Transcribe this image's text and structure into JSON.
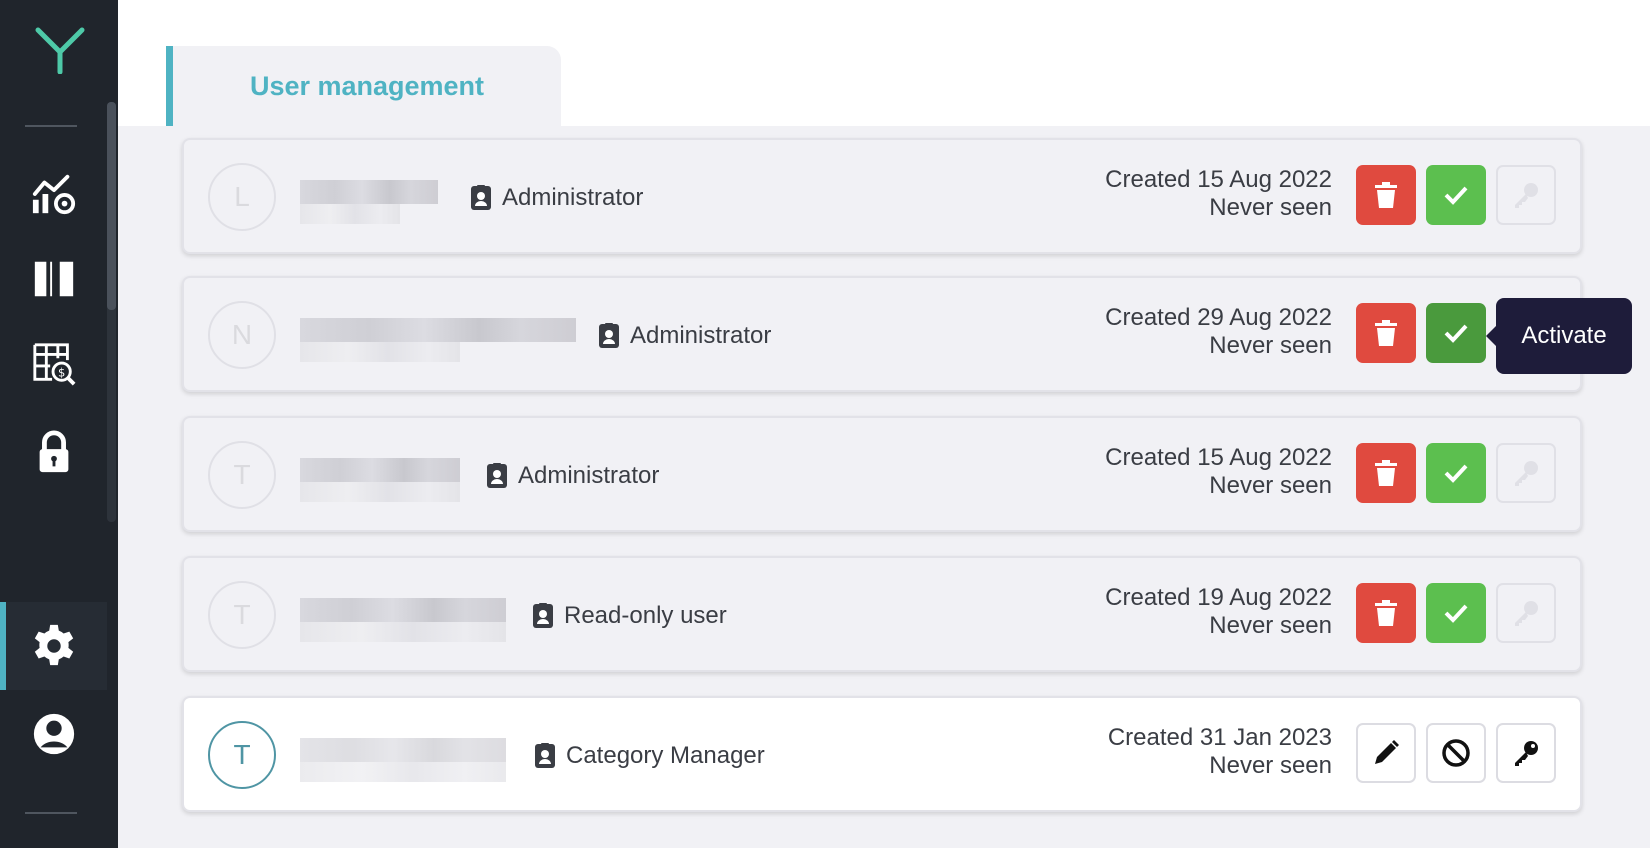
{
  "sidebar": {
    "items": [
      {
        "name": "analytics",
        "icon": "chart-gear-icon"
      },
      {
        "name": "layout",
        "icon": "columns-icon"
      },
      {
        "name": "pricing",
        "icon": "price-search-icon"
      },
      {
        "name": "security",
        "icon": "lock-icon"
      },
      {
        "name": "settings",
        "icon": "gear-icon",
        "active": true
      },
      {
        "name": "profile",
        "icon": "user-circle-icon"
      }
    ]
  },
  "header": {
    "tab_label": "User management"
  },
  "tooltip": {
    "text": "Activate"
  },
  "users": [
    {
      "initial": "L",
      "role": "Administrator",
      "created": "Created 15 Aug 2022",
      "seen": "Never seen",
      "active": false
    },
    {
      "initial": "N",
      "role": "Administrator",
      "created": "Created 29 Aug 2022",
      "seen": "Never seen",
      "active": false
    },
    {
      "initial": "T",
      "role": "Administrator",
      "created": "Created 15 Aug 2022",
      "seen": "Never seen",
      "active": false
    },
    {
      "initial": "T",
      "role": "Read-only user",
      "created": "Created 19 Aug 2022",
      "seen": "Never seen",
      "active": false
    },
    {
      "initial": "T",
      "role": "Category Manager",
      "created": "Created 31 Jan 2023",
      "seen": "Never seen",
      "active": true
    }
  ],
  "colors": {
    "accent": "#4fb3c3",
    "sidebar": "#20252c",
    "delete": "#e04a3f",
    "activate": "#5cbf4f",
    "tooltip": "#1e1c3a"
  }
}
